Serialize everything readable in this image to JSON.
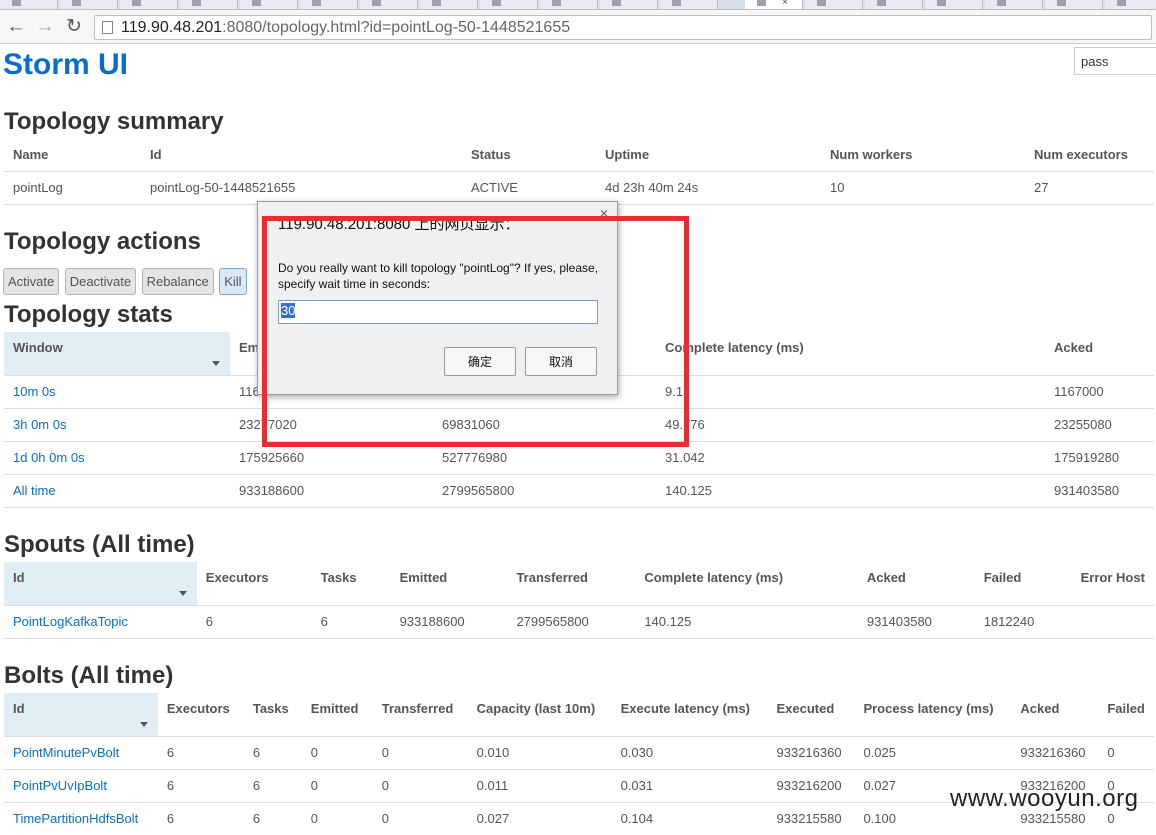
{
  "browser": {
    "url_host": "119.90.48.201",
    "url_rest": ":8080/topology.html?id=pointLog-50-1448521655"
  },
  "header": {
    "title": "Storm UI",
    "search_value": "pass"
  },
  "summary": {
    "heading": "Topology summary",
    "columns": [
      "Name",
      "Id",
      "Status",
      "Uptime",
      "Num workers",
      "Num executors"
    ],
    "row": [
      "pointLog",
      "pointLog-50-1448521655",
      "ACTIVE",
      "4d 23h 40m 24s",
      "10",
      "27"
    ]
  },
  "actions": {
    "heading": "Topology actions",
    "buttons": [
      "Activate",
      "Deactivate",
      "Rebalance",
      "Kill"
    ]
  },
  "stats": {
    "heading": "Topology stats",
    "columns": [
      "Window",
      "Em",
      "",
      "Complete latency (ms)",
      "Acked"
    ],
    "rows": [
      [
        "10m 0s",
        "116",
        "",
        "9.1",
        "1167000"
      ],
      [
        "3h 0m 0s",
        "23277020",
        "69831060",
        "49.776",
        "23255080"
      ],
      [
        "1d 0h 0m 0s",
        "175925660",
        "527776980",
        "31.042",
        "175919280"
      ],
      [
        "All time",
        "933188600",
        "2799565800",
        "140.125",
        "931403580"
      ]
    ]
  },
  "spouts": {
    "heading": "Spouts (All time)",
    "columns": [
      "Id",
      "Executors",
      "Tasks",
      "Emitted",
      "Transferred",
      "Complete latency (ms)",
      "Acked",
      "Failed",
      "Error Host"
    ],
    "rows": [
      [
        "PointLogKafkaTopic",
        "6",
        "6",
        "933188600",
        "2799565800",
        "140.125",
        "931403580",
        "1812240",
        ""
      ]
    ]
  },
  "bolts": {
    "heading": "Bolts (All time)",
    "columns": [
      "Id",
      "Executors",
      "Tasks",
      "Emitted",
      "Transferred",
      "Capacity (last 10m)",
      "Execute latency (ms)",
      "Executed",
      "Process latency (ms)",
      "Acked",
      "Failed"
    ],
    "rows": [
      [
        "PointMinutePvBolt",
        "6",
        "6",
        "0",
        "0",
        "0.010",
        "0.030",
        "933216360",
        "0.025",
        "933216360",
        "0"
      ],
      [
        "PointPvUvIpBolt",
        "6",
        "6",
        "0",
        "0",
        "0.011",
        "0.031",
        "933216200",
        "0.027",
        "933216200",
        "0"
      ],
      [
        "TimePartitionHdfsBolt",
        "6",
        "6",
        "0",
        "0",
        "0.027",
        "0.104",
        "933215580",
        "0.100",
        "933215580",
        "0"
      ]
    ]
  },
  "dialog": {
    "title": "119.90.48.201:8080 上的网页显示：",
    "close": "×",
    "message": "Do you really want to kill topology \"pointLog\"? If yes, please, specify wait time in seconds:",
    "input_value": "30",
    "ok_label": "确定",
    "cancel_label": "取消"
  },
  "watermark": "www.wooyun.org",
  "colors": {
    "link": "#0a6ec8",
    "title": "#0a6ec8",
    "highlight_header": "#e1edf5",
    "annotation_box": "#ec2a30"
  }
}
